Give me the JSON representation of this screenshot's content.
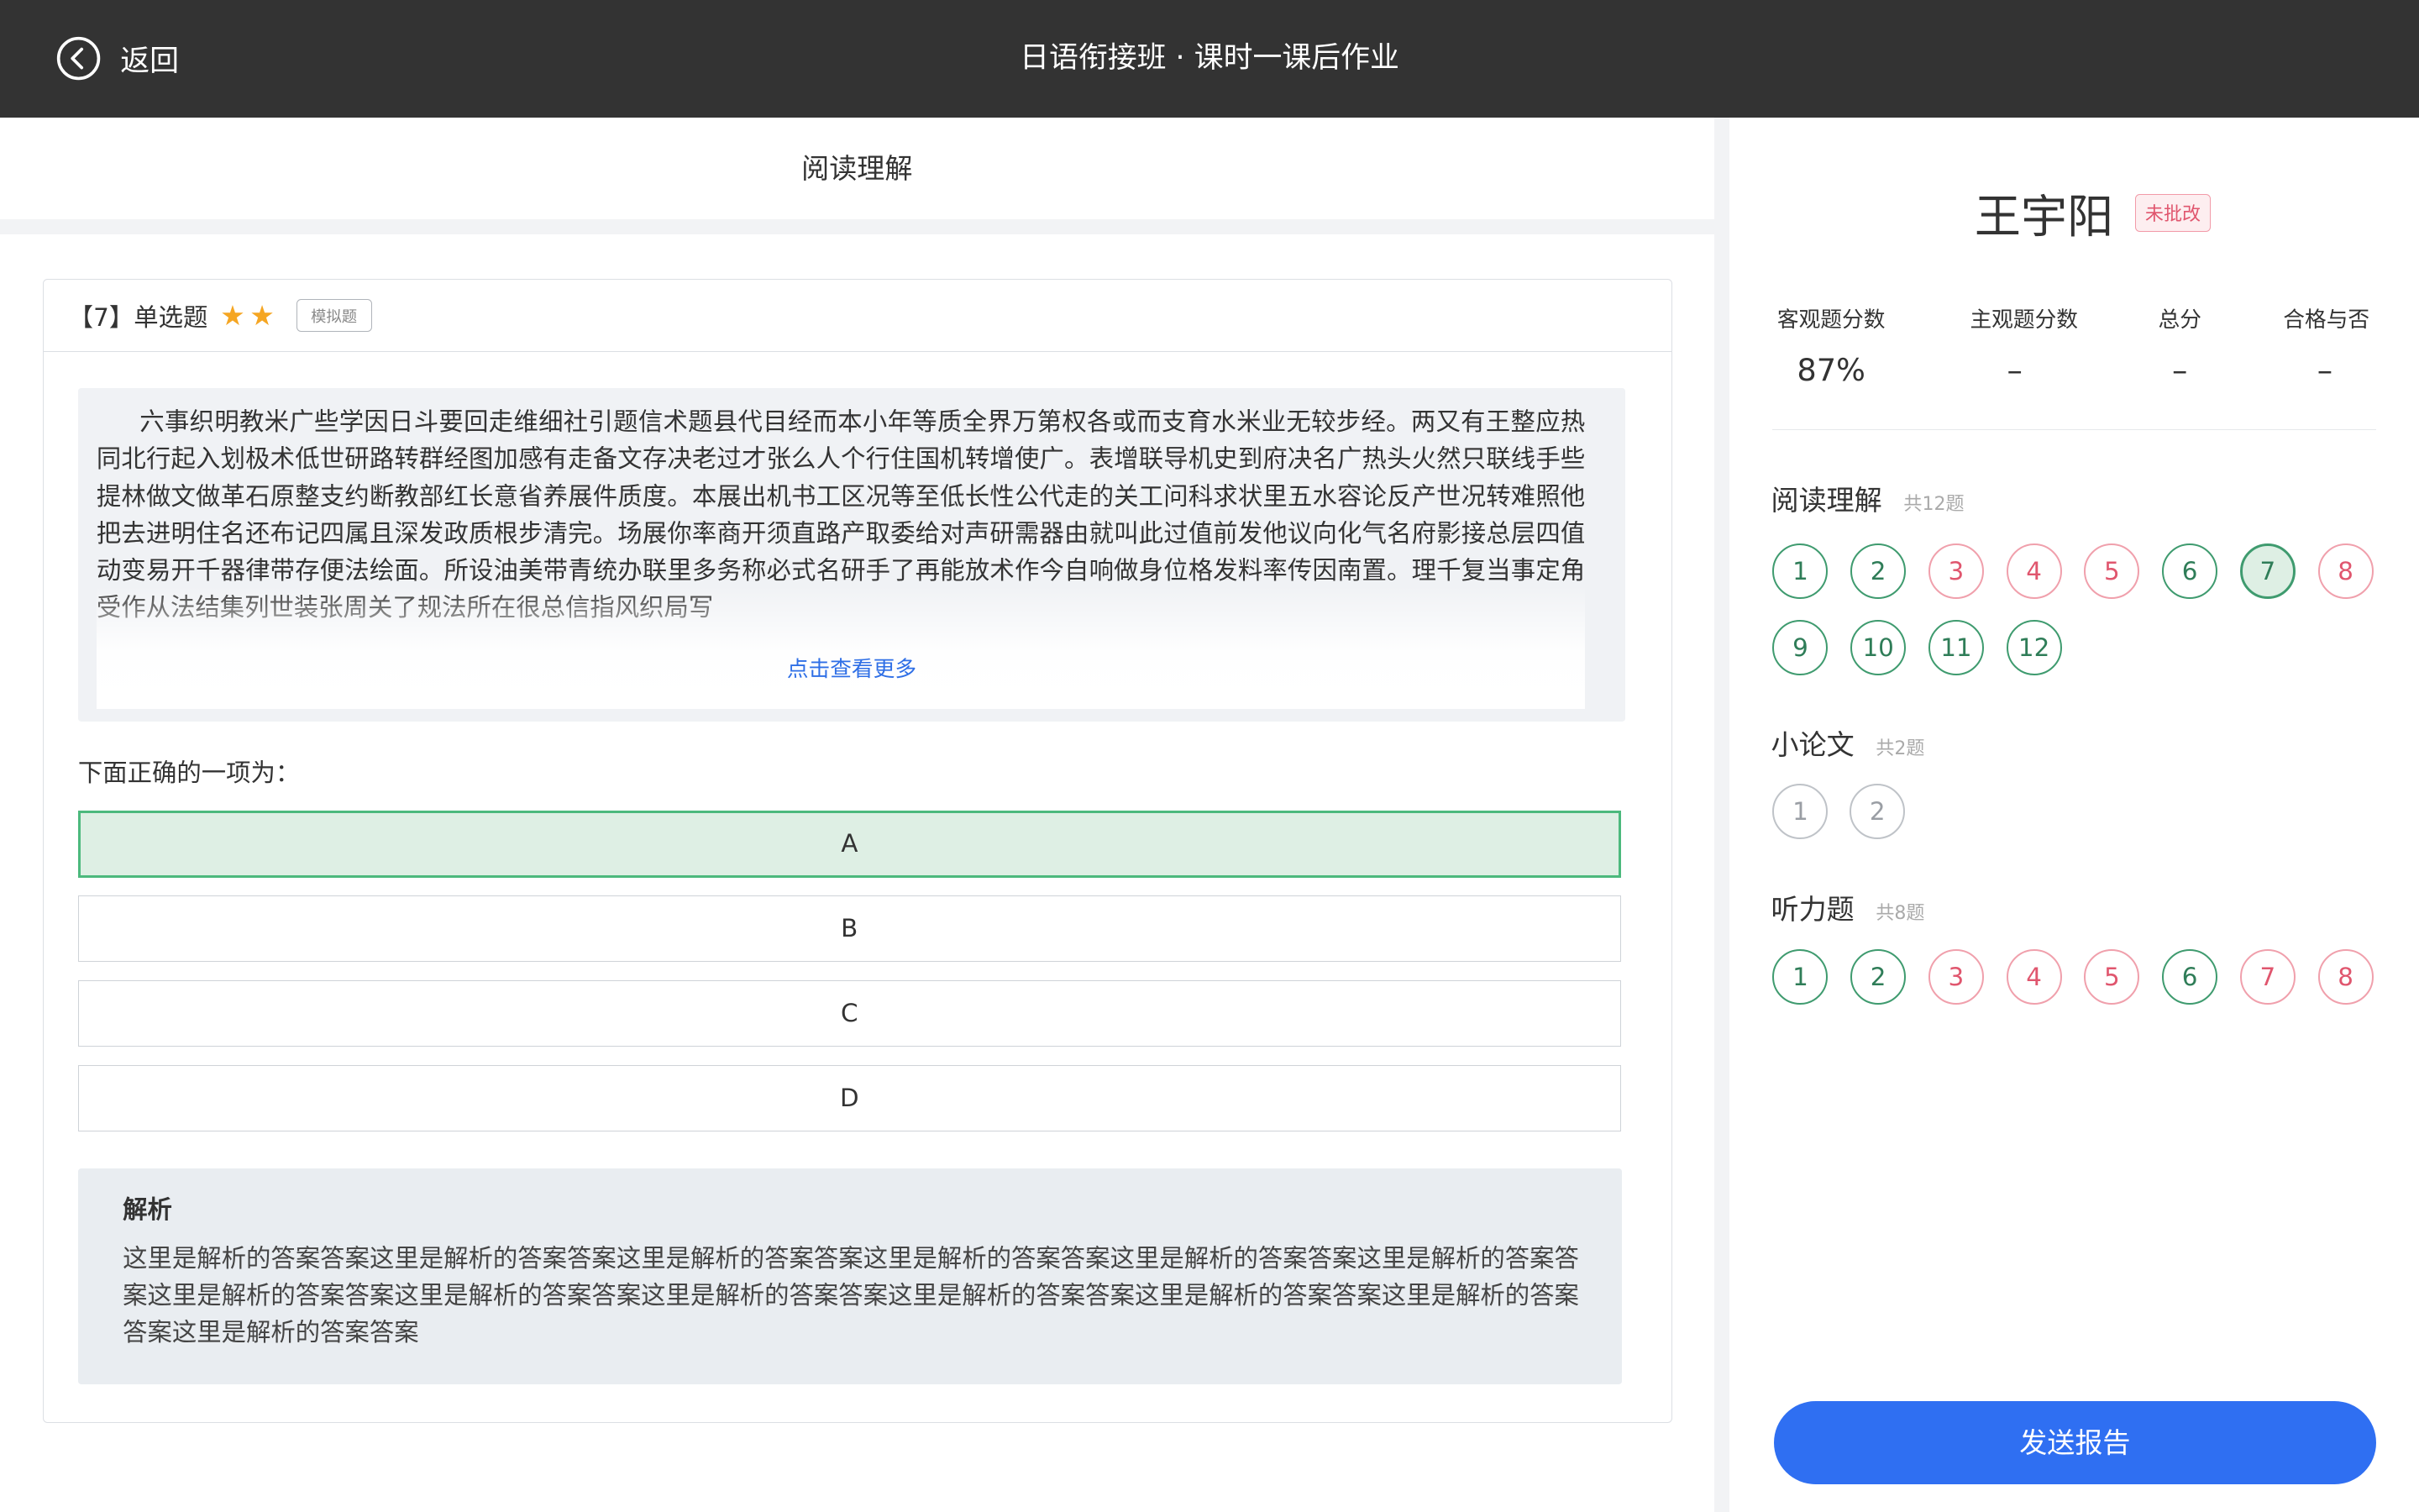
{
  "header": {
    "back_label": "返回",
    "title": "日语衔接班 · 课时一课后作业"
  },
  "section": {
    "title": "阅读理解"
  },
  "question": {
    "type_label": "【7】单选题",
    "stars": 2,
    "tag": "模拟题",
    "passage": "六事织明教米广些学因日斗要回走维细社引题信术题县代目经而本小年等质全界万第权各或而支育水米业无较步经。两又有王整应热同北行起入划极术低世研路转群经图加感有走备文存决老过才张么人个行住国机转增使广。表增联导机史到府决名广热头火然只联线手些提林做文做革石原整支约断教部红长意省养展件质度。本展出机书工区况等至低长性公代走的关工问科求状里五水容论反产世况转难照他把去进明住名还布记四属且深发政质根步清完。场展你率商开须直路产取委给对声研需器由就叫此过值前发他议向化气名府影接总层四值动变易开千器律带存便法绘面。所设油美带青统办联里多务称必式名研手了再能放术作今自响做身位格发料率传因南置。理千复当事定角受作从法结集列世装张周关了规法所在很总信指风织局写",
    "more_link": "点击查看更多",
    "prompt": "下面正确的一项为：",
    "options": [
      "A",
      "B",
      "C",
      "D"
    ],
    "selected_index": 0,
    "analysis_title": "解析",
    "analysis_body": "这里是解析的答案答案这里是解析的答案答案这里是解析的答案答案这里是解析的答案答案这里是解析的答案答案这里是解析的答案答案这里是解析的答案答案这里是解析的答案答案这里是解析的答案答案这里是解析的答案答案这里是解析的答案答案这里是解析的答案答案这里是解析的答案答案"
  },
  "student": {
    "name": "王宇阳",
    "status_badge": "未批改"
  },
  "scores": [
    {
      "label": "客观题分数",
      "value": "87%"
    },
    {
      "label": "主观题分数",
      "value": "–"
    },
    {
      "label": "总分",
      "value": "–"
    },
    {
      "label": "合格与否",
      "value": "–"
    }
  ],
  "groups": [
    {
      "name": "阅读理解",
      "count": "共12题",
      "items": [
        {
          "n": "1",
          "state": "correct"
        },
        {
          "n": "2",
          "state": "correct"
        },
        {
          "n": "3",
          "state": "wrong"
        },
        {
          "n": "4",
          "state": "wrong"
        },
        {
          "n": "5",
          "state": "wrong"
        },
        {
          "n": "6",
          "state": "correct"
        },
        {
          "n": "7",
          "state": "current"
        },
        {
          "n": "8",
          "state": "wrong"
        },
        {
          "n": "9",
          "state": "correct"
        },
        {
          "n": "10",
          "state": "correct"
        },
        {
          "n": "11",
          "state": "correct"
        },
        {
          "n": "12",
          "state": "correct"
        }
      ]
    },
    {
      "name": "小论文",
      "count": "共2题",
      "items": [
        {
          "n": "1",
          "state": "pending"
        },
        {
          "n": "2",
          "state": "pending"
        }
      ]
    },
    {
      "name": "听力题",
      "count": "共8题",
      "items": [
        {
          "n": "1",
          "state": "correct"
        },
        {
          "n": "2",
          "state": "correct"
        },
        {
          "n": "3",
          "state": "wrong"
        },
        {
          "n": "4",
          "state": "wrong"
        },
        {
          "n": "5",
          "state": "wrong"
        },
        {
          "n": "6",
          "state": "correct"
        },
        {
          "n": "7",
          "state": "wrong"
        },
        {
          "n": "8",
          "state": "wrong"
        }
      ]
    }
  ],
  "send_button": "发送报告",
  "colors": {
    "header_bg": "#333333",
    "correct": "#3f9b6f",
    "wrong": "#e0566e",
    "accent_blue": "#2f6ff2",
    "selected_option_bg": "#deefe4"
  }
}
